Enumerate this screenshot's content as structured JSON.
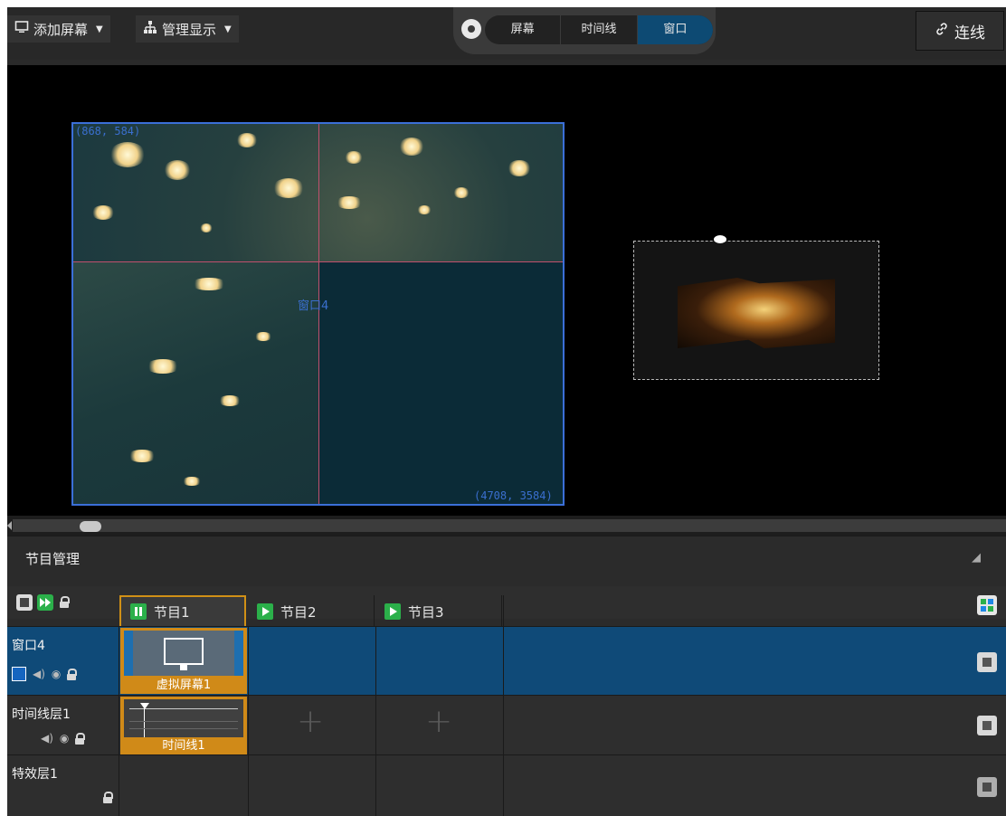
{
  "toolbar": {
    "add_screen_label": "添加屏幕",
    "manage_display_label": "管理显示",
    "tabs": [
      {
        "label": "屏幕",
        "active": false
      },
      {
        "label": "时间线",
        "active": false
      },
      {
        "label": "窗口",
        "active": true
      }
    ],
    "link_label": "连线"
  },
  "canvas": {
    "screen_top_left_coord": "(868, 584)",
    "screen_bottom_right_coord": "(4708, 3584)",
    "window_label": "窗口4"
  },
  "panel": {
    "title": "节目管理",
    "programs": [
      {
        "label": "节目1",
        "state": "playing",
        "selected": true
      },
      {
        "label": "节目2",
        "state": "paused",
        "selected": false
      },
      {
        "label": "节目3",
        "state": "paused",
        "selected": false
      }
    ],
    "layers": [
      {
        "name": "窗口4",
        "clip_label": "虚拟屏幕1"
      },
      {
        "name": "时间线层1",
        "clip_label": "时间线1"
      },
      {
        "name": "特效层1",
        "clip_label": ""
      }
    ]
  },
  "colors": {
    "accent": "#0d4a73",
    "selected_row": "#0f4a78",
    "clip_orange": "#d08a18",
    "play_green": "#2bb04a",
    "window_border": "#3b6fd8"
  }
}
